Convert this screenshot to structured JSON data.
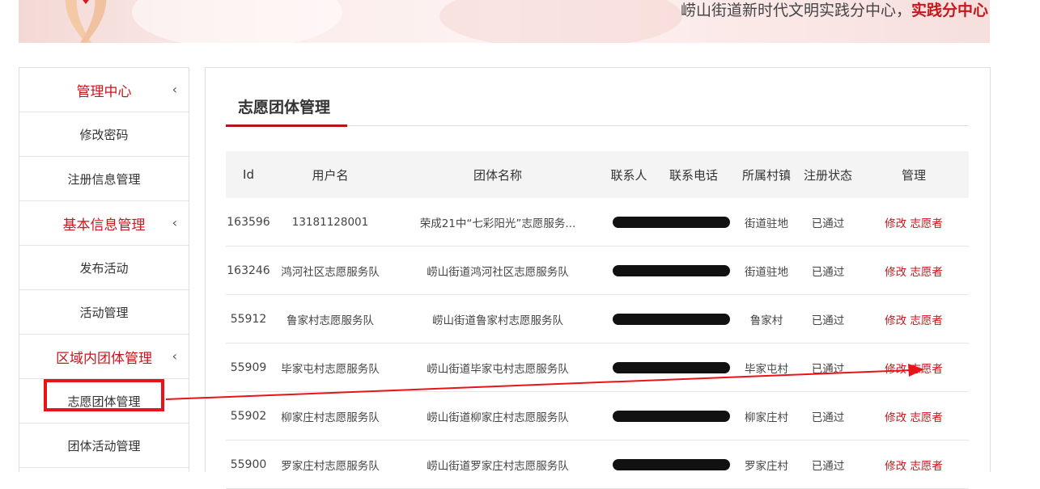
{
  "header": {
    "banner_text": "崂山街道新时代文明实践分中心，",
    "banner_accent": "实践分中心"
  },
  "sidebar": {
    "items": [
      {
        "label": "管理中心",
        "group": true
      },
      {
        "label": "修改密码",
        "group": false
      },
      {
        "label": "注册信息管理",
        "group": false
      },
      {
        "label": "基本信息管理",
        "group": true
      },
      {
        "label": "发布活动",
        "group": false
      },
      {
        "label": "活动管理",
        "group": false
      },
      {
        "label": "区域内团体管理",
        "group": true
      },
      {
        "label": "志愿团体管理",
        "group": false
      },
      {
        "label": "团体活动管理",
        "group": false
      }
    ],
    "chevron": "‹"
  },
  "main": {
    "title": "志愿团体管理",
    "columns": [
      "Id",
      "用户名",
      "团体名称",
      "联系人",
      "联系电话",
      "所属村镇",
      "注册状态",
      "管理"
    ],
    "rows": [
      {
        "id": "163596",
        "user": "13181128001",
        "group": "荣成21中“七彩阳光”志愿服务...",
        "village": "街道驻地",
        "status": "已通过"
      },
      {
        "id": "163246",
        "user": "鸿河社区志愿服务队",
        "group": "崂山街道鸿河社区志愿服务队",
        "village": "街道驻地",
        "status": "已通过"
      },
      {
        "id": "55912",
        "user": "鲁家村志愿服务队",
        "group": "崂山街道鲁家村志愿服务队",
        "village": "鲁家村",
        "status": "已通过"
      },
      {
        "id": "55909",
        "user": "毕家屯村志愿服务队",
        "group": "崂山街道毕家屯村志愿服务队",
        "village": "毕家屯村",
        "status": "已通过"
      },
      {
        "id": "55902",
        "user": "柳家庄村志愿服务队",
        "group": "崂山街道柳家庄村志愿服务队",
        "village": "柳家庄村",
        "status": "已通过"
      },
      {
        "id": "55900",
        "user": "罗家庄村志愿服务队",
        "group": "崂山街道罗家庄村志愿服务队",
        "village": "罗家庄村",
        "status": "已通过"
      }
    ],
    "actions": {
      "edit": "修改",
      "volunteer": "志愿者"
    }
  },
  "colors": {
    "accent": "#c8161d",
    "annotation": "#e8141a"
  }
}
